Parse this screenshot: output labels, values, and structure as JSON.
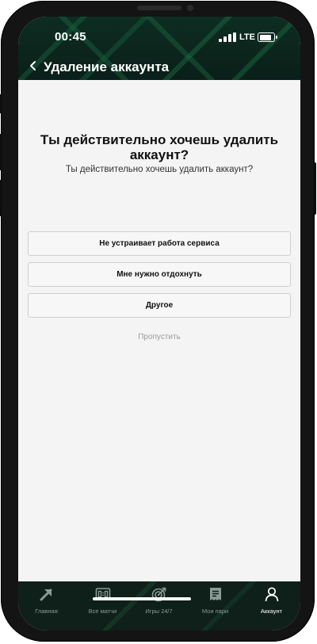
{
  "status": {
    "time": "00:45",
    "network": "LTE",
    "battery_percent": 85
  },
  "header": {
    "title": "Удаление аккаунта"
  },
  "main": {
    "heading": "Ты действительно хочешь удалить аккаунт?",
    "subheading": "Ты действительно хочешь удалить аккаунт?",
    "options": [
      "Не устраивает работа сервиса",
      "Мне нужно отдохнуть",
      "Другое"
    ],
    "skip_label": "Пропустить"
  },
  "tabbar": {
    "items": [
      {
        "label": "Главная",
        "icon": "arrow-icon"
      },
      {
        "label": "Все матчи",
        "icon": "scoreboard-icon"
      },
      {
        "label": "Игры 24/7",
        "icon": "target-icon"
      },
      {
        "label": "Мои пари",
        "icon": "receipt-icon"
      },
      {
        "label": "Аккаунт",
        "icon": "user-icon"
      }
    ],
    "active_index": 4
  },
  "colors": {
    "accent_dark": "#0d2d22",
    "text": "#111111",
    "muted": "#9a9a9a"
  }
}
